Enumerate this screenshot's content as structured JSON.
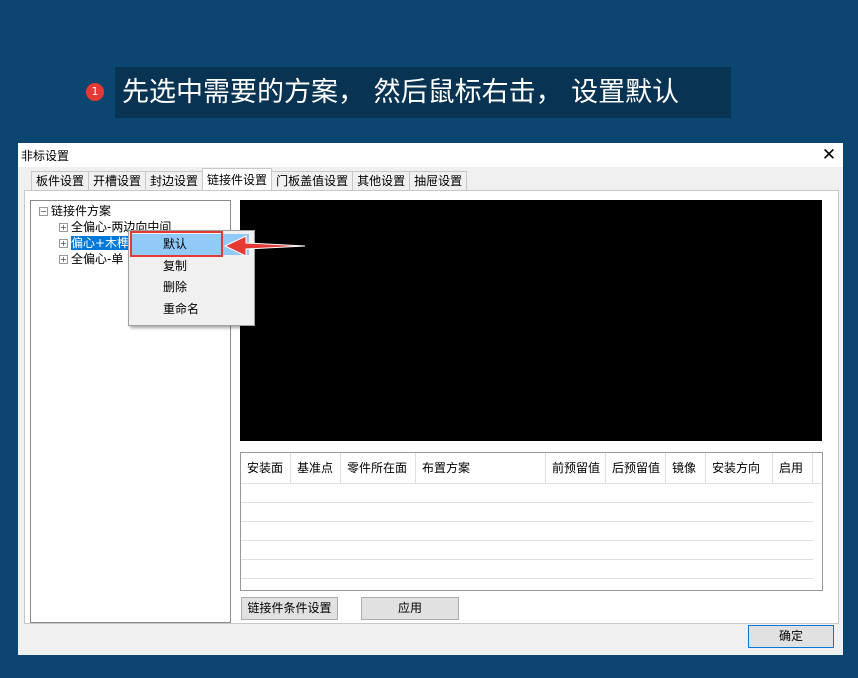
{
  "instruction": {
    "step": "1",
    "text": "先选中需要的方案， 然后鼠标右击， 设置默认"
  },
  "window": {
    "title": "非标设置",
    "close": "✕"
  },
  "tabs": [
    "板件设置",
    "开槽设置",
    "封边设置",
    "链接件设置",
    "门板盖值设置",
    "其他设置",
    "抽屉设置"
  ],
  "active_tab": "链接件设置",
  "tree": {
    "root": "链接件方案",
    "items": [
      "全偏心-两边向中间",
      "偏心+木榫",
      "全偏心-单"
    ]
  },
  "context_menu": {
    "items": [
      "默认",
      "复制",
      "删除",
      "重命名"
    ],
    "highlighted": "默认"
  },
  "table": {
    "headers": [
      "安装面",
      "基准点",
      "零件所在面",
      "布置方案",
      "前预留值",
      "后预留值",
      "镜像",
      "安装方向",
      "启用"
    ]
  },
  "buttons": {
    "conditions": "链接件条件设置",
    "apply": "应用",
    "ok": "确定"
  },
  "colors": {
    "background": "#0b4670",
    "highlight": "#e53935",
    "selection": "#0078d7"
  }
}
